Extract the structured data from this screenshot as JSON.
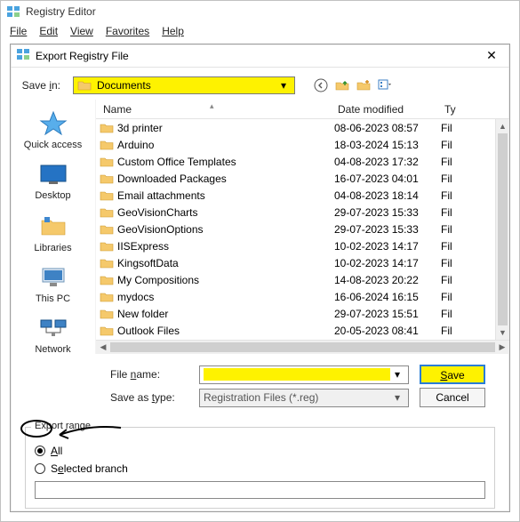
{
  "app": {
    "title": "Registry Editor"
  },
  "menu": {
    "file": "File",
    "edit": "Edit",
    "view": "View",
    "favorites": "Favorites",
    "help": "Help"
  },
  "dialog": {
    "title": "Export Registry File",
    "save_in_label": "Save in:",
    "save_in_value": "Documents",
    "columns": {
      "name": "Name",
      "date": "Date modified",
      "type": "Ty"
    },
    "file_name_label": "File name:",
    "file_name_value": "",
    "save_as_type_label": "Save as type:",
    "save_as_type_value": "Registration Files (*.reg)",
    "save_button": "Save",
    "cancel_button": "Cancel"
  },
  "places": [
    {
      "label": "Quick access"
    },
    {
      "label": "Desktop"
    },
    {
      "label": "Libraries"
    },
    {
      "label": "This PC"
    },
    {
      "label": "Network"
    }
  ],
  "files": [
    {
      "name": "3d printer",
      "date": "08-06-2023 08:57",
      "type": "Fil"
    },
    {
      "name": "Arduino",
      "date": "18-03-2024 15:13",
      "type": "Fil"
    },
    {
      "name": "Custom Office Templates",
      "date": "04-08-2023 17:32",
      "type": "Fil"
    },
    {
      "name": "Downloaded Packages",
      "date": "16-07-2023 04:01",
      "type": "Fil"
    },
    {
      "name": "Email attachments",
      "date": "04-08-2023 18:14",
      "type": "Fil"
    },
    {
      "name": "GeoVisionCharts",
      "date": "29-07-2023 15:33",
      "type": "Fil"
    },
    {
      "name": "GeoVisionOptions",
      "date": "29-07-2023 15:33",
      "type": "Fil"
    },
    {
      "name": "IISExpress",
      "date": "10-02-2023 14:17",
      "type": "Fil"
    },
    {
      "name": "KingsoftData",
      "date": "10-02-2023 14:17",
      "type": "Fil"
    },
    {
      "name": "My Compositions",
      "date": "14-08-2023 20:22",
      "type": "Fil"
    },
    {
      "name": "mydocs",
      "date": "16-06-2024 16:15",
      "type": "Fil"
    },
    {
      "name": "New folder",
      "date": "29-07-2023 15:51",
      "type": "Fil"
    },
    {
      "name": "Outlook Files",
      "date": "20-05-2023 08:41",
      "type": "Fil"
    }
  ],
  "export_range": {
    "legend": "Export range",
    "all_label": "All",
    "selected_branch_label": "Selected branch",
    "selected_radio": "all",
    "branch_path": ""
  }
}
